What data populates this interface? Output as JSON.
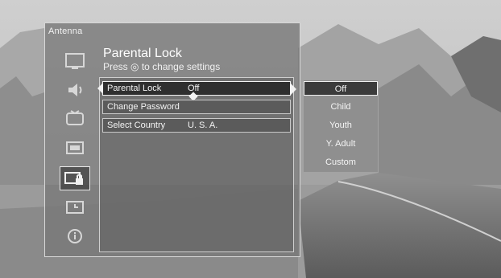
{
  "menu": {
    "source_title": "Antenna",
    "title": "Parental Lock",
    "subtitle": "Press ◎ to change settings",
    "rail_icons": [
      {
        "name": "picture-icon",
        "active": false
      },
      {
        "name": "audio-icon",
        "active": false
      },
      {
        "name": "channel-icon",
        "active": false
      },
      {
        "name": "setup-icon",
        "active": false
      },
      {
        "name": "lock-icon",
        "active": true
      },
      {
        "name": "timer-icon",
        "active": false
      },
      {
        "name": "info-icon",
        "active": false
      }
    ],
    "rows": [
      {
        "label": "Parental Lock",
        "value": "Off"
      },
      {
        "label": "Change Password",
        "value": ""
      },
      {
        "label": "Select Country",
        "value": "U. S. A."
      }
    ]
  },
  "options": {
    "items": [
      "Off",
      "Child",
      "Youth",
      "Y. Adult",
      "Custom"
    ],
    "selected": "Off"
  }
}
